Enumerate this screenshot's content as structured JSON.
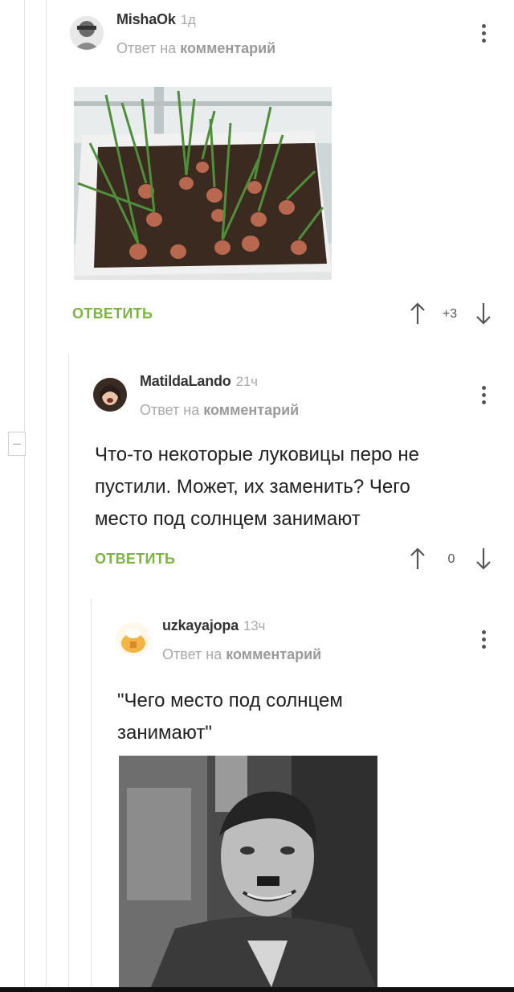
{
  "comments": [
    {
      "author": "MishaOk",
      "time": "1д",
      "reply_prefix": "Ответ на",
      "reply_target": "комментарий",
      "reply_button": "ОТВЕТИТЬ",
      "score": "+3",
      "image_icon": "onion-sprouts-photo"
    },
    {
      "author": "MatildaLando",
      "time": "21ч",
      "reply_prefix": "Ответ на",
      "reply_target": "комментарий",
      "text_lines": [
        "Что-то некоторые луковицы перо не",
        "пустили. Может, их заменить? Чего",
        "место под солнцем занимают"
      ],
      "reply_button": "ОТВЕТИТЬ",
      "score": "0"
    },
    {
      "author": "uzkayajopa",
      "time": "13ч",
      "reply_prefix": "Ответ на",
      "reply_target": "комментарий",
      "text_lines": [
        "\"Чего место под солнцем",
        "занимают\""
      ],
      "image_icon": "laughing-man-bw-photo"
    }
  ],
  "colors": {
    "accent": "#7cb342",
    "muted": "#a9a9a9",
    "thread": "#e3e3e3"
  }
}
